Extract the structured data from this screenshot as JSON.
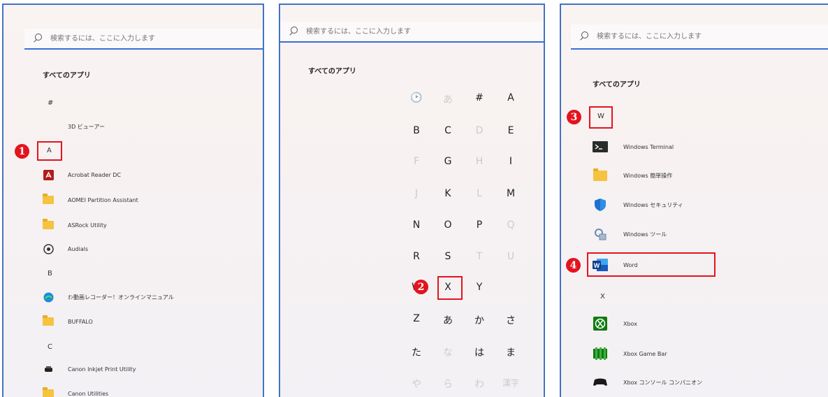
{
  "panels": [
    {
      "search_placeholder": "検索するには、ここに入力します",
      "heading": "すべてのアプリ",
      "rows": [
        {
          "type": "letter",
          "text": "#"
        },
        {
          "type": "app",
          "label": "3D ビューアー",
          "icon": "cube-3d-icon"
        },
        {
          "type": "letter",
          "text": "A"
        },
        {
          "type": "app",
          "label": "Acrobat Reader DC",
          "icon": "acrobat-icon"
        },
        {
          "type": "app",
          "label": "AOMEI Partition Assistant",
          "icon": "folder-icon"
        },
        {
          "type": "app",
          "label": "ASRock Utility",
          "icon": "folder-icon"
        },
        {
          "type": "app",
          "label": "Audials",
          "icon": "audials-icon"
        },
        {
          "type": "letter",
          "text": "B"
        },
        {
          "type": "app",
          "label": "ｵﾝ動画レコーダー！オンラインマニュアル",
          "icon": "edge-icon"
        },
        {
          "type": "app",
          "label": "BUFFALO",
          "icon": "folder-icon"
        },
        {
          "type": "letter",
          "text": "C"
        },
        {
          "type": "app",
          "label": "Canon Inkjet Print Utility",
          "icon": "printer-icon"
        },
        {
          "type": "app",
          "label": "Canon Utilities",
          "icon": "folder-icon"
        }
      ],
      "callout": "1"
    },
    {
      "search_placeholder": "検索するには、ここに入力します",
      "heading": "すべてのアプリ",
      "grid": [
        [
          "🕑",
          "あ",
          "#",
          "A"
        ],
        [
          "B",
          "C",
          "D",
          "E"
        ],
        [
          "F",
          "G",
          "H",
          "I"
        ],
        [
          "J",
          "K",
          "L",
          "M"
        ],
        [
          "N",
          "O",
          "P",
          "Q"
        ],
        [
          "R",
          "S",
          "T",
          "U"
        ],
        [
          "W",
          "X",
          "Y",
          ""
        ],
        [
          "Z",
          "あ",
          "か",
          "さ"
        ],
        [
          "た",
          "な",
          "は",
          "ま"
        ],
        [
          "や",
          "ら",
          "わ",
          "漢字"
        ]
      ],
      "dim": [
        "0-0",
        "0-1",
        "1-2",
        "2-0",
        "2-2",
        "3-0",
        "3-2",
        "4-3",
        "5-2",
        "5-3",
        "8-1",
        "9-0",
        "9-1",
        "9-2",
        "9-3"
      ],
      "callout": "2"
    },
    {
      "search_placeholder": "検索するには、ここに入力します",
      "heading": "すべてのアプリ",
      "rows": [
        {
          "type": "letter",
          "text": "W"
        },
        {
          "type": "app",
          "label": "Windows Terminal",
          "icon": "terminal-icon"
        },
        {
          "type": "app",
          "label": "Windows 簡単操作",
          "icon": "folder-icon"
        },
        {
          "type": "app",
          "label": "Windows セキュリティ",
          "icon": "shield-icon"
        },
        {
          "type": "app",
          "label": "Windows ツール",
          "icon": "tools-icon"
        },
        {
          "type": "app",
          "label": "Word",
          "icon": "word-icon"
        },
        {
          "type": "letter",
          "text": "X"
        },
        {
          "type": "app",
          "label": "Xbox",
          "icon": "xbox-icon"
        },
        {
          "type": "app",
          "label": "Xbox Game Bar",
          "icon": "xbox-game-bar-icon"
        },
        {
          "type": "app",
          "label": "Xbox コンソール コンパニオン",
          "icon": "xbox-controller-icon"
        }
      ],
      "callouts": [
        "3",
        "4"
      ]
    }
  ]
}
